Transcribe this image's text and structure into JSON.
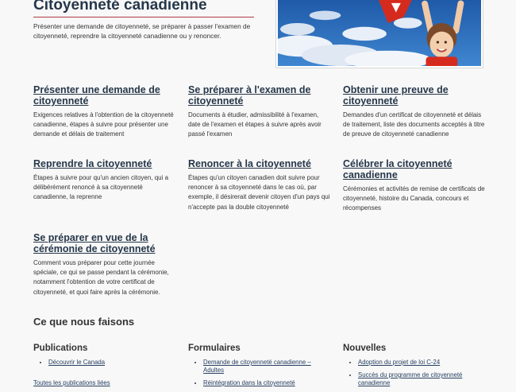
{
  "header": {
    "title": "Citoyenneté canadienne",
    "intro": "Présenter une demande de citoyenneté, se préparer à passer l'examen de citoyenneté, reprendre la citoyenneté canadienne ou y renoncer."
  },
  "cards": [
    {
      "title": "Présenter une demande de citoyenneté",
      "desc": "Exigences relatives à l'obtention de la citoyenneté canadienne, étapes à suivre pour présenter une demande et délais de traitement"
    },
    {
      "title": "Se préparer à l'examen de citoyenneté",
      "desc": "Documents à étudier, admissibilité à l'examen, date de l'examen et étapes à suivre après avoir passé l'examen"
    },
    {
      "title": "Obtenir une preuve de citoyenneté",
      "desc": "Demandes d'un certificat de citoyenneté et délais de traitement, liste des documents acceptés à titre de preuve de citoyenneté canadienne"
    },
    {
      "title": "Reprendre la citoyenneté",
      "desc": "Étapes à suivre pour qu'un ancien citoyen, qui a délibérément renoncé à sa citoyenneté canadienne, la reprenne"
    },
    {
      "title": "Renoncer à la citoyenneté",
      "desc": "Étapes qu'un citoyen canadien doit suivre pour renoncer à sa citoyenneté dans le cas où, par exemple, il désirerait devenir citoyen d'un pays qui n'accepte pas la double citoyenneté"
    },
    {
      "title": "Célébrer la citoyenneté canadienne",
      "desc": "Cérémonies et activités de remise de certificats de citoyenneté, histoire du Canada, concours et récompenses"
    },
    {
      "title": "Se préparer en vue de la cérémonie de citoyenneté",
      "desc": "Comment vous préparer pour cette journée spéciale, ce qui se passe pendant la cérémonie, notamment l'obtention de votre certificat de citoyenneté, et quoi faire après la cérémonie."
    }
  ],
  "what_we_do": {
    "heading": "Ce que nous faisons",
    "publications": {
      "heading": "Publications",
      "items": [
        "Découvrir le Canada"
      ],
      "all_link": "Toutes les publications liées"
    },
    "forms": {
      "heading": "Formulaires",
      "items": [
        "Demande de citoyenneté canadienne – Adultes",
        "Réintégration dans la citoyenneté"
      ]
    },
    "news": {
      "heading": "Nouvelles",
      "items": [
        "Adoption du projet de loi C-24",
        "Succès du programme de citoyenneté canadienne"
      ]
    }
  },
  "colors": {
    "heading_blue": "#26374a",
    "link_blue": "#284162",
    "accent_red": "#af3c43"
  }
}
